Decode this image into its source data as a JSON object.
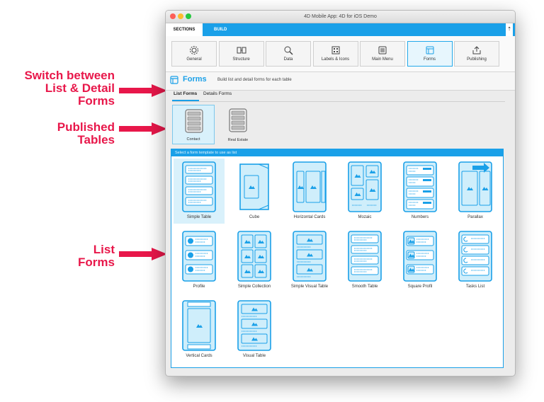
{
  "annotations": {
    "switch": [
      "Switch between",
      "List & Detail",
      "Forms"
    ],
    "published": [
      "Published",
      "Tables"
    ],
    "list": [
      "List",
      "Forms"
    ]
  },
  "window": {
    "title": "4D Mobile App: 4D for iOS Demo"
  },
  "tabs": {
    "sections": "SECTIONS",
    "build": "BUILD",
    "share_glyph": "⇡"
  },
  "sections": [
    {
      "label": "General",
      "icon": "gear-icon"
    },
    {
      "label": "Structure",
      "icon": "structure-icon"
    },
    {
      "label": "Data",
      "icon": "data-icon"
    },
    {
      "label": "Labels & Icons",
      "icon": "labels-icon"
    },
    {
      "label": "Main Menu",
      "icon": "menu-icon"
    },
    {
      "label": "Forms",
      "icon": "forms-icon"
    },
    {
      "label": "Publishing",
      "icon": "publishing-icon"
    }
  ],
  "selected_section": "Forms",
  "header": {
    "title": "Forms",
    "description": "Build list and detail forms for each table"
  },
  "subtabs": {
    "list": "List Forms",
    "detail": "Details Forms"
  },
  "tables": [
    "Contact",
    "Real Estate"
  ],
  "panel_header": "Select a form template to use as list",
  "forms": [
    "Simple Table",
    "Cube",
    "Horizontal Cards",
    "Mozaic",
    "Numbers",
    "Parallax",
    "Profile",
    "Simple Collection",
    "Simple Visual Table",
    "Smooth Table",
    "Square Profil",
    "Tasks List",
    "Vertical Cards",
    "Visual Table"
  ],
  "colors": {
    "accent": "#1aa0e8",
    "annotation": "#e8174a",
    "selected_bg": "#d9f1fb"
  }
}
